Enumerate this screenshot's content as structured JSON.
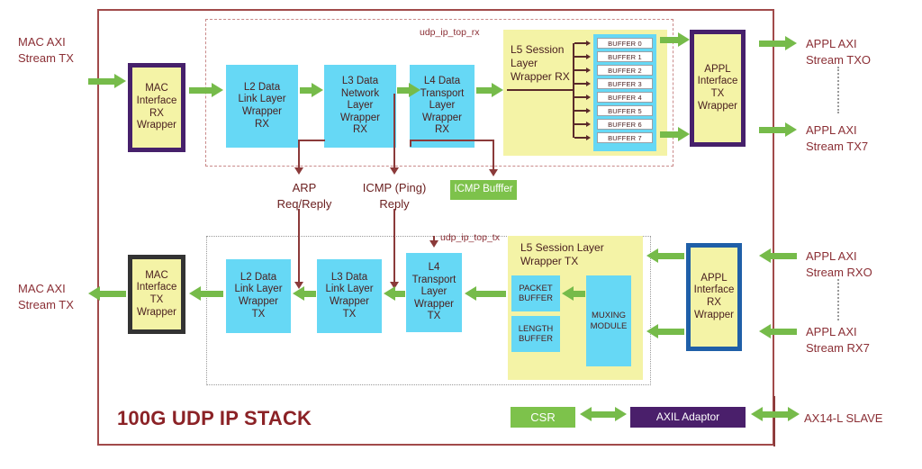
{
  "diagram": {
    "title": "100G UDP IP STACK",
    "rx_module_label": "udp_ip_top_rx",
    "tx_module_label": "udp_ip_top_tx"
  },
  "colors": {
    "stack_border": "#a14a4a",
    "cyan_block": "#66d8f5",
    "yellow_block": "#f4f3a6",
    "green_block": "#7dc24b",
    "purple_block": "#4a1f6b",
    "arrow_green": "#76bb4a",
    "line_maroon": "#8b3a3a",
    "text_maroon": "#8b2f35",
    "wrapper_purple_border": "#46206b",
    "wrapper_black_border": "#333333",
    "wrapper_blue_border": "#1f5fa8"
  },
  "io_labels": {
    "mac_axi_stream_tx_in": "MAC AXI\nStream TX",
    "mac_axi_stream_tx_out": "MAC AXI\nStream TX",
    "appl_axi_stream_tx0": "APPL AXI\nStream TXO",
    "appl_axi_stream_tx7": "APPL AXI\nStream TX7",
    "appl_axi_stream_rx0": "APPL AXI\nStream RXO",
    "appl_axi_stream_rx7": "APPL AXI\nStream RX7",
    "axi4_lite_slave": "AX14-L SLAVE"
  },
  "rx_path": {
    "mac_interface_rx_wrapper": "MAC\nInterface\nRX\nWrapper",
    "l2": "L2 Data\nLink Layer\nWrapper\nRX",
    "l3": "L3 Data\nNetwork\nLayer\nWrapper\nRX",
    "l4": "L4 Data\nTransport\nLayer\nWrapper\nRX",
    "l5_title": "L5 Session\nLayer\nWrapper RX",
    "appl_interface_tx_wrapper": "APPL\nInterface\nTX\nWrapper",
    "buffers": [
      "BUFFER 0",
      "BUFFER 1",
      "BUFFER 2",
      "BUFFER 3",
      "BUFFER 4",
      "BUFFER 5",
      "BUFFER 6",
      "BUFFER 7"
    ]
  },
  "middle_taps": {
    "arp": "ARP\nReq/Reply",
    "icmp_ping": "ICMP (Ping)\nReply",
    "icmp_buffer": "ICMP Bufffer"
  },
  "tx_path": {
    "mac_interface_tx_wrapper": "MAC\nInterface\nTX\nWrapper",
    "l2": "L2 Data\nLink Layer\nWrapper\nTX",
    "l3": "L3 Data\nLink Layer\nWrapper\nTX",
    "l4": "L4\nTransport\nLayer\nWrapper\nTX",
    "l5_title": "L5 Session Layer\nWrapper TX",
    "packet_buffer": "PACKET\nBUFFER",
    "length_buffer": "LENGTH\nBUFFER",
    "muxing_module": "MUXING\nMODULE",
    "appl_interface_rx_wrapper": "APPL\nInterface\nRX\nWrapper"
  },
  "control": {
    "csr": "CSR",
    "axil_adaptor": "AXIL Adaptor"
  }
}
